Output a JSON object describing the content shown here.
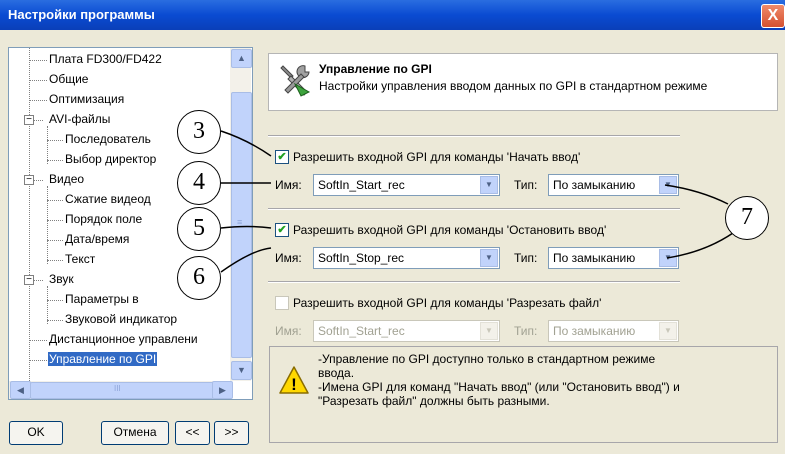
{
  "window": {
    "title": "Настройки программы",
    "close_glyph": "X"
  },
  "tree": {
    "items": [
      {
        "label": "Плата FD300/FD422"
      },
      {
        "label": "Общие"
      },
      {
        "label": "Оптимизация"
      },
      {
        "label": "AVI-файлы",
        "expander": "−"
      },
      {
        "label": "Последователь"
      },
      {
        "label": "Выбор директор"
      },
      {
        "label": "Видео",
        "expander": "−"
      },
      {
        "label": "Сжатие видеод"
      },
      {
        "label": "Порядок поле"
      },
      {
        "label": "Дата/время"
      },
      {
        "label": "Текст"
      },
      {
        "label": "Звук",
        "expander": "−"
      },
      {
        "label": "Параметры в"
      },
      {
        "label": "Звуковой индикатор"
      },
      {
        "label": "Дистанционное управлени"
      },
      {
        "label": "Управление по GPI"
      }
    ],
    "scroll_up": "▲",
    "scroll_down": "▼",
    "scroll_left": "◀",
    "scroll_right": "▶",
    "grip": "≡",
    "hgrip": "III"
  },
  "buttons": {
    "ok": "OK",
    "cancel": "Отмена",
    "prev": "<<",
    "next": ">>"
  },
  "panel": {
    "icon": "tools-icon",
    "title": "Управление по GPI",
    "description": "Настройки управления вводом данных по GPI в стандартном режиме"
  },
  "gpi": [
    {
      "checkbox_label": "Разрешить входной GPI для команды 'Начать ввод'",
      "checked": true,
      "name_label": "Имя:",
      "name_value": "SoftIn_Start_rec",
      "type_label": "Тип:",
      "type_value": "По замыканию"
    },
    {
      "checkbox_label": "Разрешить входной GPI для команды 'Остановить ввод'",
      "checked": true,
      "name_label": "Имя:",
      "name_value": "SoftIn_Stop_rec",
      "type_label": "Тип:",
      "type_value": "По замыканию"
    },
    {
      "checkbox_label": "Разрешить входной GPI для команды 'Разрезать файл'",
      "checked": false,
      "name_label": "Имя:",
      "name_value": "SoftIn_Start_rec",
      "type_label": "Тип:",
      "type_value": "По замыканию"
    }
  ],
  "check_glyph": "✔",
  "combo_arrow": "▼",
  "warning": {
    "icon": "warning-icon",
    "icon_glyph": "!",
    "lines": [
      "-Управление по GPI доступно только в стандартном режиме",
      "ввода.",
      "-Имена GPI для команд \"Начать ввод\" (или \"Остановить ввод\") и",
      "\"Разрезать файл\" должны быть разными."
    ]
  },
  "callouts": [
    "3",
    "4",
    "5",
    "6",
    "7"
  ]
}
